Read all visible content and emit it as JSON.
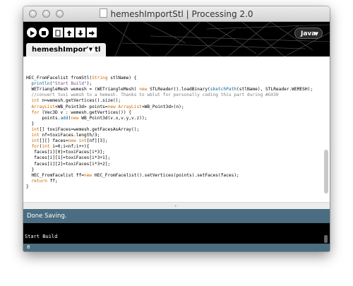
{
  "window": {
    "title": "hemeshImportStl | Processing 2.0"
  },
  "toolbar": {
    "mode_label": "Java",
    "mode_arrow": "▼",
    "tab_label": "hemeshImportStl",
    "tab_menu_symbol": "▼",
    "icons": {
      "run": "play-icon",
      "stop": "stop-icon",
      "new": "new-file-icon",
      "open": "open-icon",
      "save": "save-icon",
      "export": "export-icon"
    }
  },
  "editor": {
    "lines": [
      "",
      "HEC_FromFacelist fromStl(String stlName) {",
      "  println(\"Start Build\");",
      "  WETriangleMesh wemesh = (WETriangleMesh) new STLReader().loadBinary(sketchPath(stlName), STLReader.WEMESH);",
      "  //convert toxi wemsh to a hemesh. Thanks to wblut for personally coding this part during #GX30",
      "  int n=wemesh.getVertices().size();",
      "  ArrayList<WB_Point3d> points=new ArrayList<WB_Point3d>(n);",
      "  for (Vec3D v : wemesh.getVertices()) {",
      "      points.add(new WB_Point3d(v.x,v.y,v.z));",
      "  }",
      "  int[] toxiFaces=wemesh.getFacesAsArray();",
      "  int nf=toxiFaces.length/3;",
      "  int[][] faces=new int[nf][3];",
      "  for(int i=0;i<nf;i++){",
      "   faces[i][0]=toxiFaces[i*3];",
      "   faces[i][1]=toxiFaces[i*3+1];",
      "   faces[i][2]=toxiFaces[i*3+2];",
      "  }",
      "  HEC_FromFacelist ff=new HEC_FromFacelist().setVertices(points).setFaces(faces);",
      "  return ff;",
      "}"
    ]
  },
  "status": {
    "message": "Done Saving."
  },
  "console": {
    "output": "Start Build"
  },
  "footer": {
    "line_number": "8"
  },
  "colors": {
    "status_bar": "#4a6d81",
    "toolbar_bg": "#000000",
    "keyword": "#cc6600",
    "function": "#006699",
    "string": "#7d4793",
    "comment": "#7e7e7e"
  }
}
